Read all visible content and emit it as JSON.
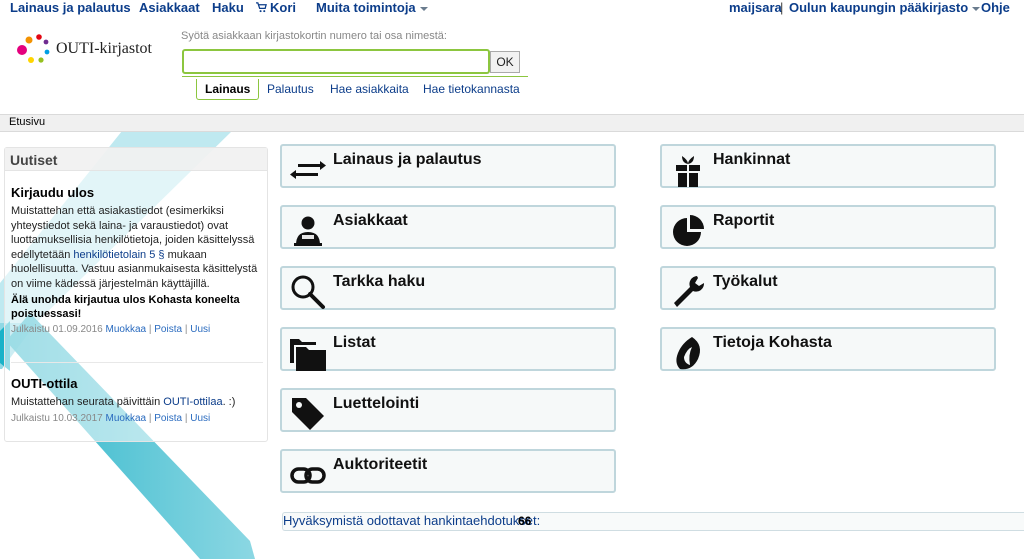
{
  "topnav": {
    "lending": "Lainaus ja palautus",
    "customers": "Asiakkaat",
    "search": "Haku",
    "cart": "Kori",
    "other": "Muita toimintoja",
    "user": "maijsara",
    "separator": "|",
    "library": "Oulun kaupungin pääkirjasto",
    "help": "Ohje"
  },
  "logo": {
    "text": "OUTI-kirjastot"
  },
  "search": {
    "label": "Syötä asiakkaan kirjastokortin numero tai osa nimestä:",
    "value": "",
    "ok_label": "OK"
  },
  "tabs": [
    {
      "label": "Lainaus",
      "active": true
    },
    {
      "label": "Palautus"
    },
    {
      "label": "Hae asiakkaita"
    },
    {
      "label": "Hae tietokannasta"
    }
  ],
  "breadcrumb": "Etusivu",
  "news": {
    "title": "Uutiset",
    "items": [
      {
        "heading": "Kirjaudu ulos",
        "body_before": "Muistattehan että asiakastiedot (esimerkiksi yhteystiedot sekä laina- ja varaustiedot) ovat luottamuksellisia henkilötietoja, joiden käsittelyssä edellytetään ",
        "body_link": "henkilötietolain 5 §",
        "body_after": " mukaan huolellisuutta. Vastuu asianmukaisesta käsittelystä on viime kädessä järjestelmän käyttäjillä.",
        "bold": "Älä unohda kirjautua ulos Kohasta koneelta poistuessasi!",
        "published": "Julkaistu 01.09.2016",
        "edit": "Muokkaa",
        "delete": "Poista",
        "new": "Uusi",
        "pipe": "|"
      },
      {
        "heading": "OUTI-ottila",
        "body_before": "Muistattehan seurata päivittäin ",
        "body_link": "OUTI-ottilaa",
        "body_after": ". :)",
        "published": "Julkaistu 10.03.2017",
        "edit": "Muokkaa",
        "delete": "Poista",
        "new": "Uusi",
        "pipe": "|"
      }
    ]
  },
  "tiles_left": [
    {
      "label": "Lainaus ja palautus",
      "icon": "exchange-arrows-icon"
    },
    {
      "label": "Asiakkaat",
      "icon": "user-icon"
    },
    {
      "label": "Tarkka haku",
      "icon": "magnifier-icon"
    },
    {
      "label": "Listat",
      "icon": "folders-icon"
    },
    {
      "label": "Luettelointi",
      "icon": "tag-icon"
    },
    {
      "label": "Auktoriteetit",
      "icon": "link-icon"
    }
  ],
  "tiles_right": [
    {
      "label": "Hankinnat",
      "icon": "gift-icon"
    },
    {
      "label": "Raportit",
      "icon": "pie-chart-icon"
    },
    {
      "label": "Työkalut",
      "icon": "wrench-icon"
    },
    {
      "label": "Tietoja Kohasta",
      "icon": "koha-logo-icon"
    }
  ],
  "status": {
    "label": "Hyväksymistä odottavat hankintaehdotukset:",
    "count": "66"
  },
  "colors": {
    "nav_text": "#0c3d8a",
    "accent_green": "#8cc63f",
    "stripe_teal": "#1ab2c8",
    "tile_border": "#bfd6dc"
  }
}
